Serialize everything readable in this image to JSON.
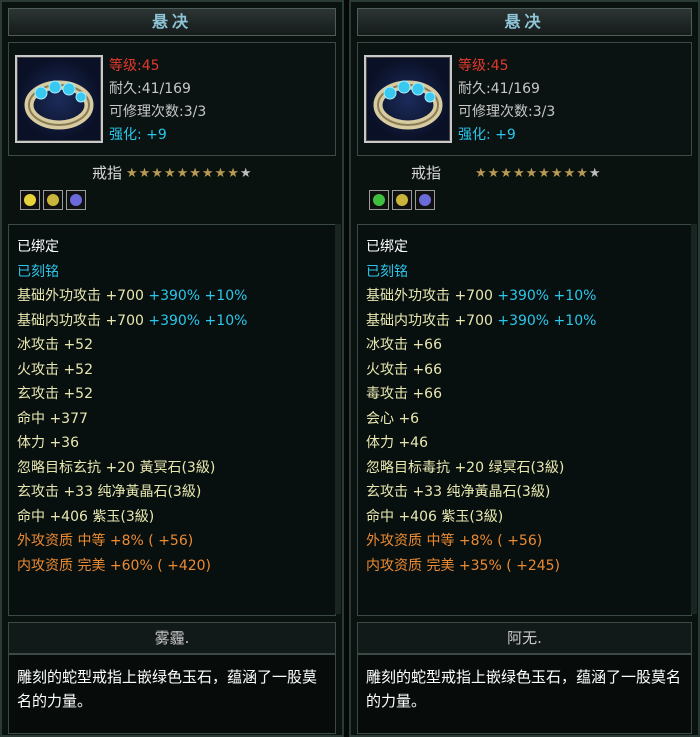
{
  "panels": [
    {
      "title": "悬决",
      "level": "等级:45",
      "durability": "耐久:41/169",
      "repair": "可修理次数:3/3",
      "enhance": "强化: +9",
      "item_type": "戒指",
      "stars": "★★★★★★★★★",
      "star_off": "★",
      "gems": [
        "#e8d23a",
        "#c9b53a",
        "#6a6ad8"
      ],
      "attrs": [
        {
          "text": "已绑定",
          "color": "white"
        },
        {
          "text": "已刻铭",
          "color": "cyan"
        },
        {
          "text": "基础外功攻击 +700",
          "extra": " +390% +10%",
          "color": "yellow"
        },
        {
          "text": "基础内功攻击 +700",
          "extra": " +390% +10%",
          "color": "yellow"
        },
        {
          "text": "冰攻击 +52",
          "color": "yellow"
        },
        {
          "text": "火攻击 +52",
          "color": "yellow"
        },
        {
          "text": "玄攻击 +52",
          "color": "yellow"
        },
        {
          "text": "命中 +377",
          "color": "yellow"
        },
        {
          "text": "体力 +36",
          "color": "yellow"
        },
        {
          "text": "忽略目标玄抗 +20 黃冥石(3級)",
          "color": "yellow"
        },
        {
          "text": "玄攻击 +33 纯净黃晶石(3級)",
          "color": "yellow"
        },
        {
          "text": "命中 +406 紫玉(3級)",
          "color": "yellow"
        },
        {
          "text": "外攻资质  中等 +8% ( +56)",
          "color": "orange"
        },
        {
          "text": "内攻资质  完美 +60% ( +420)",
          "color": "orange"
        }
      ],
      "owner": "雾霾.",
      "description": "雕刻的蛇型戒指上嵌绿色玉石，蕴涵了一股莫名的力量。"
    },
    {
      "title": "悬决",
      "level": "等级:45",
      "durability": "耐久:41/169",
      "repair": "可修理次数:3/3",
      "enhance": "强化: +9",
      "item_type": "戒指",
      "stars": "★★★★★★★★★",
      "star_off": "★",
      "gems": [
        "#3fbe3f",
        "#c9b53a",
        "#6a6ad8"
      ],
      "attrs": [
        {
          "text": "已绑定",
          "color": "white"
        },
        {
          "text": "已刻铭",
          "color": "cyan"
        },
        {
          "text": "基础外功攻击 +700",
          "extra": " +390% +10%",
          "color": "yellow"
        },
        {
          "text": "基础内功攻击 +700",
          "extra": " +390% +10%",
          "color": "yellow"
        },
        {
          "text": "冰攻击 +66",
          "color": "yellow"
        },
        {
          "text": "火攻击 +66",
          "color": "yellow"
        },
        {
          "text": "毒攻击 +66",
          "color": "yellow"
        },
        {
          "text": "会心 +6",
          "color": "yellow"
        },
        {
          "text": "体力 +46",
          "color": "yellow"
        },
        {
          "text": "忽略目标毒抗 +20 绿冥石(3級)",
          "color": "yellow"
        },
        {
          "text": "玄攻击 +33 纯净黃晶石(3級)",
          "color": "yellow"
        },
        {
          "text": "命中 +406 紫玉(3級)",
          "color": "yellow"
        },
        {
          "text": "外攻资质  中等 +8% ( +56)",
          "color": "orange"
        },
        {
          "text": "内攻资质  完美 +35% ( +245)",
          "color": "orange"
        }
      ],
      "owner": "阿无.",
      "description": "雕刻的蛇型戒指上嵌绿色玉石，蕴涵了一股莫名的力量。"
    }
  ]
}
